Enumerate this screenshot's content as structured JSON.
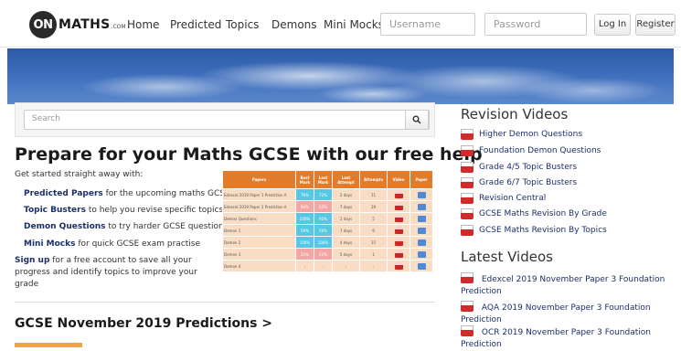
{
  "header": {
    "logo_on": "ON",
    "logo_name": "MATHS",
    "logo_com": ".COM",
    "nav": [
      "Home",
      "Predicted",
      "Topics",
      "Demons",
      "Mini Mocks"
    ],
    "username_placeholder": "Username",
    "password_placeholder": "Password",
    "login_label": "Log In",
    "register_label": "Register"
  },
  "search": {
    "placeholder": "Search",
    "icon": "search-icon"
  },
  "main": {
    "heading": "Prepare for your Maths GCSE with our free help",
    "intro": "Get started straight away with:",
    "features": [
      {
        "bold": "Predicted Papers",
        "text": " for the upcoming maths GCSE"
      },
      {
        "bold": "Topic Busters",
        "text": " to help you revise specific topics"
      },
      {
        "bold": "Demon Questions",
        "text": " to try harder GCSE questions"
      },
      {
        "bold": "Mini Mocks",
        "text": " for quick GCSE exam practise"
      }
    ],
    "signup_bold": "Sign up",
    "signup_text": " for a free account to save all your progress and identify topics to improve your grade",
    "section_title": "GCSE November 2019 Predictions >"
  },
  "table": {
    "headers": [
      "Papers",
      "Best Mark",
      "Last Mark",
      "Last Attempt",
      "Attempts",
      "Video",
      "Paper"
    ],
    "rows": [
      {
        "paper": "Edexcel 2019 Paper 1 Prediction A",
        "best": "76%",
        "last": "72%",
        "when": "2 days",
        "attempts": "11"
      },
      {
        "paper": "Edexcel 2019 Paper 2 Prediction A",
        "best": "94%",
        "last": "63%",
        "when": "7 days",
        "attempts": "29"
      },
      {
        "paper": "Demon Questions",
        "best": "100%",
        "last": "91%",
        "when": "2 days",
        "attempts": "5"
      },
      {
        "paper": "Demon 1",
        "best": "59%",
        "last": "50%",
        "when": "7 days",
        "attempts": "9"
      },
      {
        "paper": "Demon 2",
        "best": "100%",
        "last": "100%",
        "when": "4 days",
        "attempts": "15"
      },
      {
        "paper": "Demon 3",
        "best": "22%",
        "last": "22%",
        "when": "5 days",
        "attempts": "1"
      },
      {
        "paper": "Demon 4",
        "best": "-",
        "last": "-",
        "when": "-",
        "attempts": "-"
      }
    ]
  },
  "sidebar": {
    "revision_title": "Revision Videos",
    "revision_items": [
      "Higher Demon Questions",
      "Foundation Demon Questions",
      "Grade 4/5 Topic Busters",
      "Grade 6/7 Topic Busters",
      "Revision Central",
      "GCSE Maths Revision By Grade",
      "GCSE Maths Revision By Topics"
    ],
    "latest_title": "Latest Videos",
    "latest_items": [
      "Edexcel 2019 November Paper 3 Foundation Prediction",
      "AQA 2019 November Paper 3 Foundation Prediction",
      "OCR 2019 November Paper 3 Foundation Prediction"
    ],
    "youtube_icon_text": "You Tube"
  },
  "colors": {
    "accent": "#e27b2a",
    "link": "#1d2f6a",
    "youtube": "#d02a2a",
    "banner": "#3d6dbb"
  }
}
